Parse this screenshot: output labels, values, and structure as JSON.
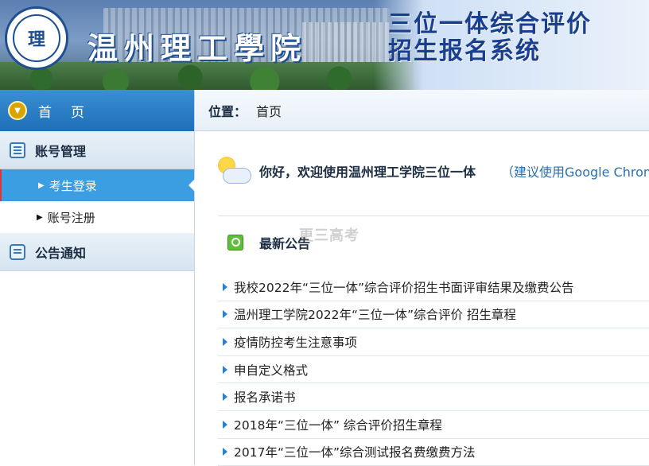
{
  "header": {
    "logo_glyph": "理",
    "school_name": "温州理工學院",
    "system_title_line1": "三位一体综合评价",
    "system_title_line2": "招生报名系统"
  },
  "sidebar": {
    "home_label": "首页",
    "sections": [
      {
        "title": "账号管理",
        "icon": "list-icon",
        "items": [
          {
            "label": "考生登录",
            "active": true
          },
          {
            "label": "账号注册",
            "active": false
          }
        ]
      },
      {
        "title": "公告通知",
        "icon": "chat-icon",
        "items": []
      }
    ]
  },
  "location": {
    "label": "位置：",
    "value": "首页"
  },
  "welcome": {
    "greeting": "你好，欢迎使用温州理工学院三位一体",
    "hint": "（建议使用Google Chrome浏览器）"
  },
  "notices": {
    "title": "最新公告",
    "watermark": "更三高考",
    "items": [
      "我校2022年“三位一体”综合评价招生书面评审结果及缴费公告",
      "温州理工学院2022年“三位一体”综合评价 招生章程",
      "疫情防控考生注意事项",
      "申自定义格式",
      "报名承诺书",
      "2018年“三位一体” 综合评价招生章程",
      "2017年“三位一体”综合测试报名费缴费方法"
    ]
  },
  "colors": {
    "primary_blue": "#1f6fb8",
    "active_item": "#3b9ee2",
    "link_blue": "#2b6fb3"
  }
}
